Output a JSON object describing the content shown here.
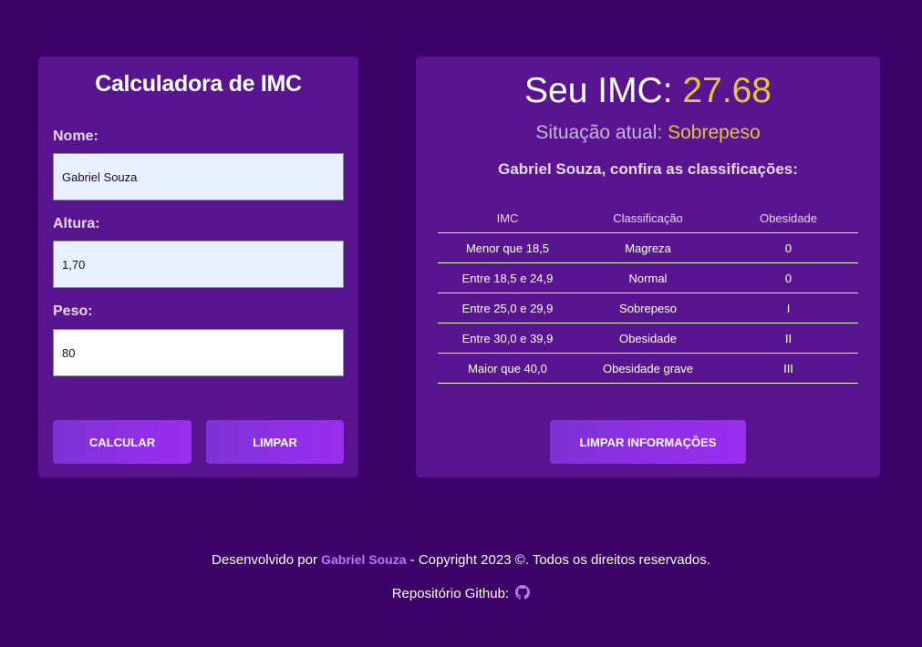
{
  "form": {
    "title": "Calculadora de IMC",
    "name_label": "Nome:",
    "name_value": "Gabriel Souza",
    "height_label": "Altura:",
    "height_value": "1,70",
    "weight_label": "Peso:",
    "weight_value": "80",
    "calc_label": "CALCULAR",
    "clear_label": "LIMPAR"
  },
  "result": {
    "imc_prefix": "Seu IMC: ",
    "imc_value": "27.68",
    "status_prefix": "Situação atual: ",
    "status_value": "Sobrepeso",
    "confira_text": "Gabriel Souza, confira as classificações:",
    "table": {
      "headers": [
        "IMC",
        "Classificação",
        "Obesidade"
      ],
      "rows": [
        [
          "Menor que 18,5",
          "Magreza",
          "0"
        ],
        [
          "Entre 18,5 e 24,9",
          "Normal",
          "0"
        ],
        [
          "Entre 25,0 e 29,9",
          "Sobrepeso",
          "I"
        ],
        [
          "Entre 30,0 e 39,9",
          "Obesidade",
          "II"
        ],
        [
          "Maior que 40,0",
          "Obesidade grave",
          "III"
        ]
      ]
    },
    "clear_info_label": "LIMPAR INFORMAÇÕES"
  },
  "footer": {
    "dev_prefix": "Desenvolvido por ",
    "author": "Gabriel Souza",
    "copyright": " - Copyright 2023 ©. Todos os direitos reservados.",
    "repo_label": "Repositório Github: ",
    "repo_icon": "github-icon"
  },
  "colors": {
    "background": "#3c0069",
    "card": "#58158f",
    "accent": "#e5c439",
    "button": "#9a2ef0",
    "link": "#b57cf3"
  }
}
